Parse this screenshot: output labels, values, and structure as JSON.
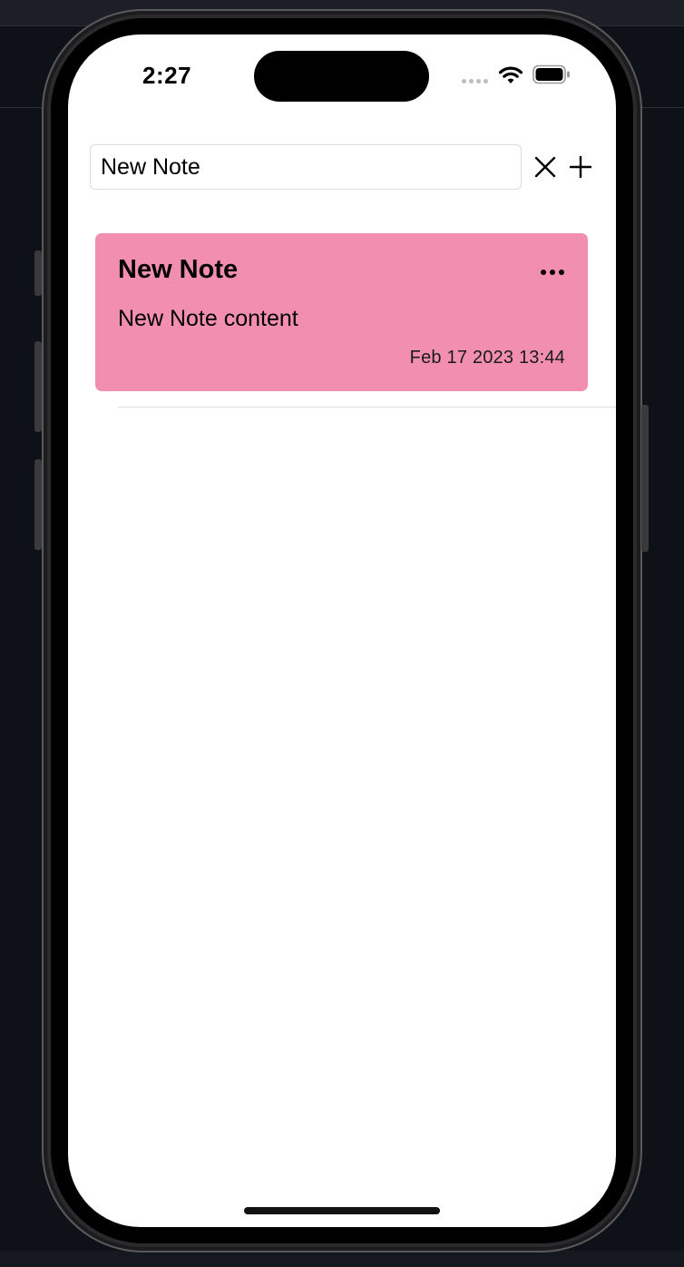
{
  "status_bar": {
    "time": "2:27",
    "icons": [
      "signal-dots-icon",
      "wifi-icon",
      "battery-icon"
    ]
  },
  "search": {
    "value": "New Note",
    "placeholder": "",
    "clear_icon": "close-icon",
    "add_icon": "plus-icon"
  },
  "notes": [
    {
      "title": "New Note",
      "content": "New Note content",
      "date": "Feb 17 2023 13:44",
      "color": "#f28fb0",
      "menu_icon": "more-horizontal-icon"
    }
  ],
  "colors": {
    "background": "#ffffff",
    "note_card": "#f28fb0",
    "text": "#000000"
  }
}
